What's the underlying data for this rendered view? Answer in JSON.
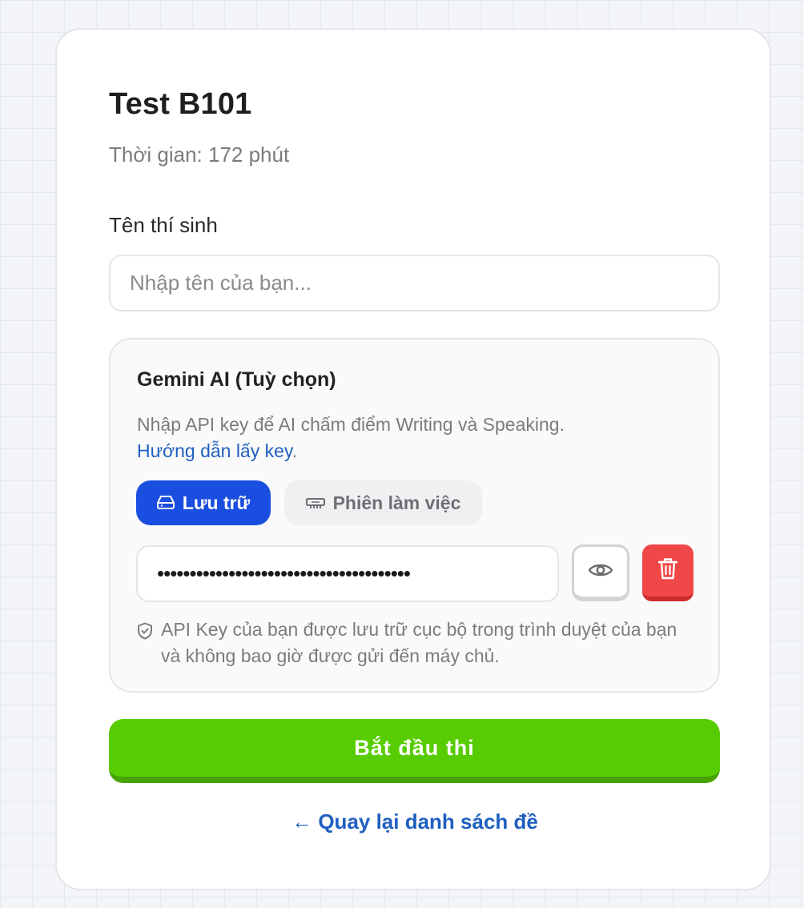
{
  "exam": {
    "title": "Test B101",
    "duration": "Thời gian: 172 phút"
  },
  "candidate": {
    "label": "Tên thí sinh",
    "placeholder": "Nhập tên của bạn...",
    "value": ""
  },
  "ai": {
    "title": "Gemini AI (Tuỳ chọn)",
    "description": "Nhập API key để AI chấm điểm Writing và Speaking.",
    "guide_link": "Hướng dẫn lấy key",
    "guide_suffix": ".",
    "modes": [
      {
        "label": "Lưu trữ",
        "icon": "hard-drive-icon",
        "active": true
      },
      {
        "label": "Phiên làm việc",
        "icon": "memory-chip-icon",
        "active": false
      }
    ],
    "api_key_masked": "•••••••••••••••••••••••••••••••••••••••",
    "toggle_visibility_icon": "eye-icon",
    "delete_icon": "trash-icon",
    "privacy_icon": "shield-icon",
    "privacy_note": "API Key của bạn được lưu trữ cục bộ trong trình duyệt của bạn và không bao giờ được gửi đến máy chủ."
  },
  "actions": {
    "start_label": "Bắt đầu thi",
    "back_label": "← Quay lại danh sách đề"
  },
  "colors": {
    "primary_blue": "#1a4ee0",
    "start_green": "#57cc02",
    "delete_red": "#f04848",
    "link_blue": "#1f5fbf"
  }
}
